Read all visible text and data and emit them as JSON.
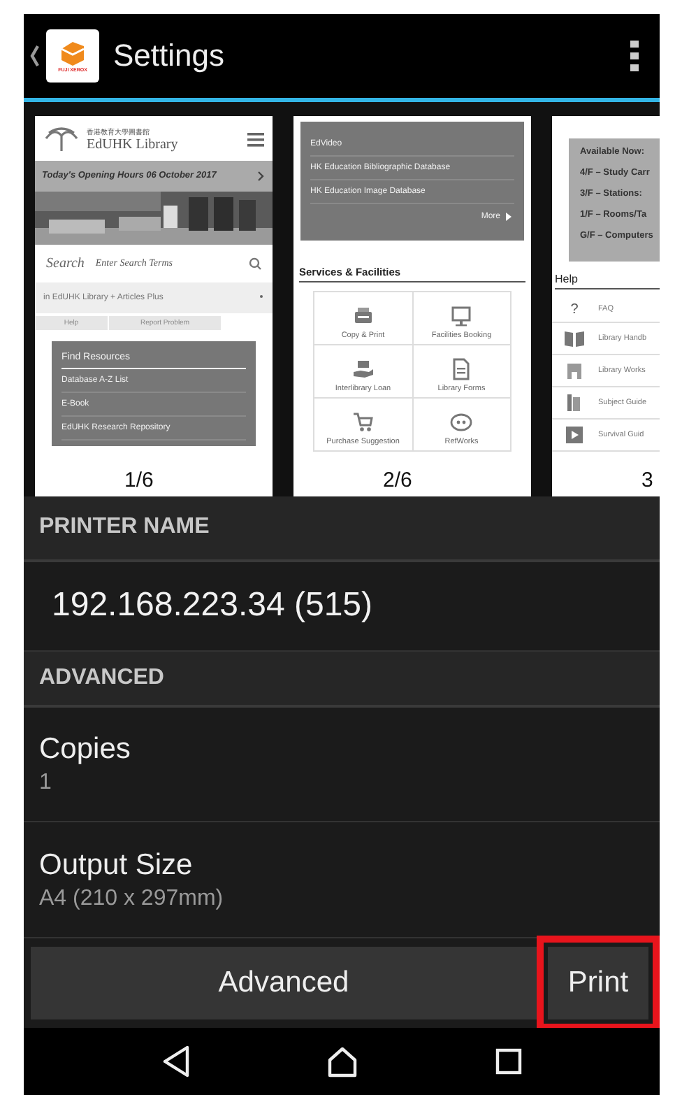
{
  "app_bar": {
    "title": "Settings",
    "logo_text": "FUJI XEROX"
  },
  "previews": [
    {
      "label": "1/6",
      "blocks": [
        {
          "kind": "logo",
          "subtitle": "香港教育大學圖書館",
          "title": "EdUHK Library"
        },
        {
          "kind": "banner",
          "text": "Today's Opening Hours  06 October 2017"
        },
        {
          "kind": "picture"
        },
        {
          "kind": "search",
          "label": "Search",
          "placeholder": "Enter Search Terms"
        },
        {
          "kind": "select",
          "value": "in EdUHK Library + Articles Plus"
        },
        {
          "kind": "buttons",
          "items": [
            "Help",
            "Report Problem"
          ]
        },
        {
          "kind": "panel",
          "title": "Find Resources",
          "items": [
            "Database A-Z List",
            "E-Book",
            "EdUHK Research Repository"
          ]
        }
      ]
    },
    {
      "label": "2/6",
      "blocks": [
        {
          "kind": "panel",
          "items": [
            "EdVideo",
            "HK Education Bibliographic Database",
            "HK Education Image Database"
          ],
          "more": "More"
        },
        {
          "kind": "heading",
          "text": "Services & Facilities"
        },
        {
          "kind": "tiles",
          "items": [
            "Copy & Print",
            "Facilities Booking",
            "Interlibrary Loan",
            "Library Forms",
            "Purchase Suggestion",
            "RefWorks"
          ]
        }
      ]
    },
    {
      "label": "3",
      "blocks": [
        {
          "kind": "notice",
          "items": [
            "Available Now:",
            "4/F – Study Carr",
            "3/F – Stations:",
            "1/F – Rooms/Ta",
            "G/F – Computers"
          ]
        },
        {
          "kind": "heading",
          "text": "Help"
        },
        {
          "kind": "list",
          "items": [
            {
              "glyph": "?",
              "text": "FAQ"
            },
            {
              "text": "Library Handb"
            },
            {
              "text": "Library Works"
            },
            {
              "text": "Subject Guide"
            },
            {
              "text": "Survival Guid"
            }
          ]
        }
      ]
    }
  ],
  "printer": {
    "header": "PRINTER NAME",
    "name": "192.168.223.34 (515)"
  },
  "advanced": {
    "header": "ADVANCED",
    "settings": [
      {
        "label": "Copies",
        "value": "1"
      },
      {
        "label": "Output Size",
        "value": "A4 (210 x 297mm)"
      }
    ]
  },
  "actions": {
    "advanced": "Advanced",
    "print": "Print",
    "highlighted": true
  }
}
